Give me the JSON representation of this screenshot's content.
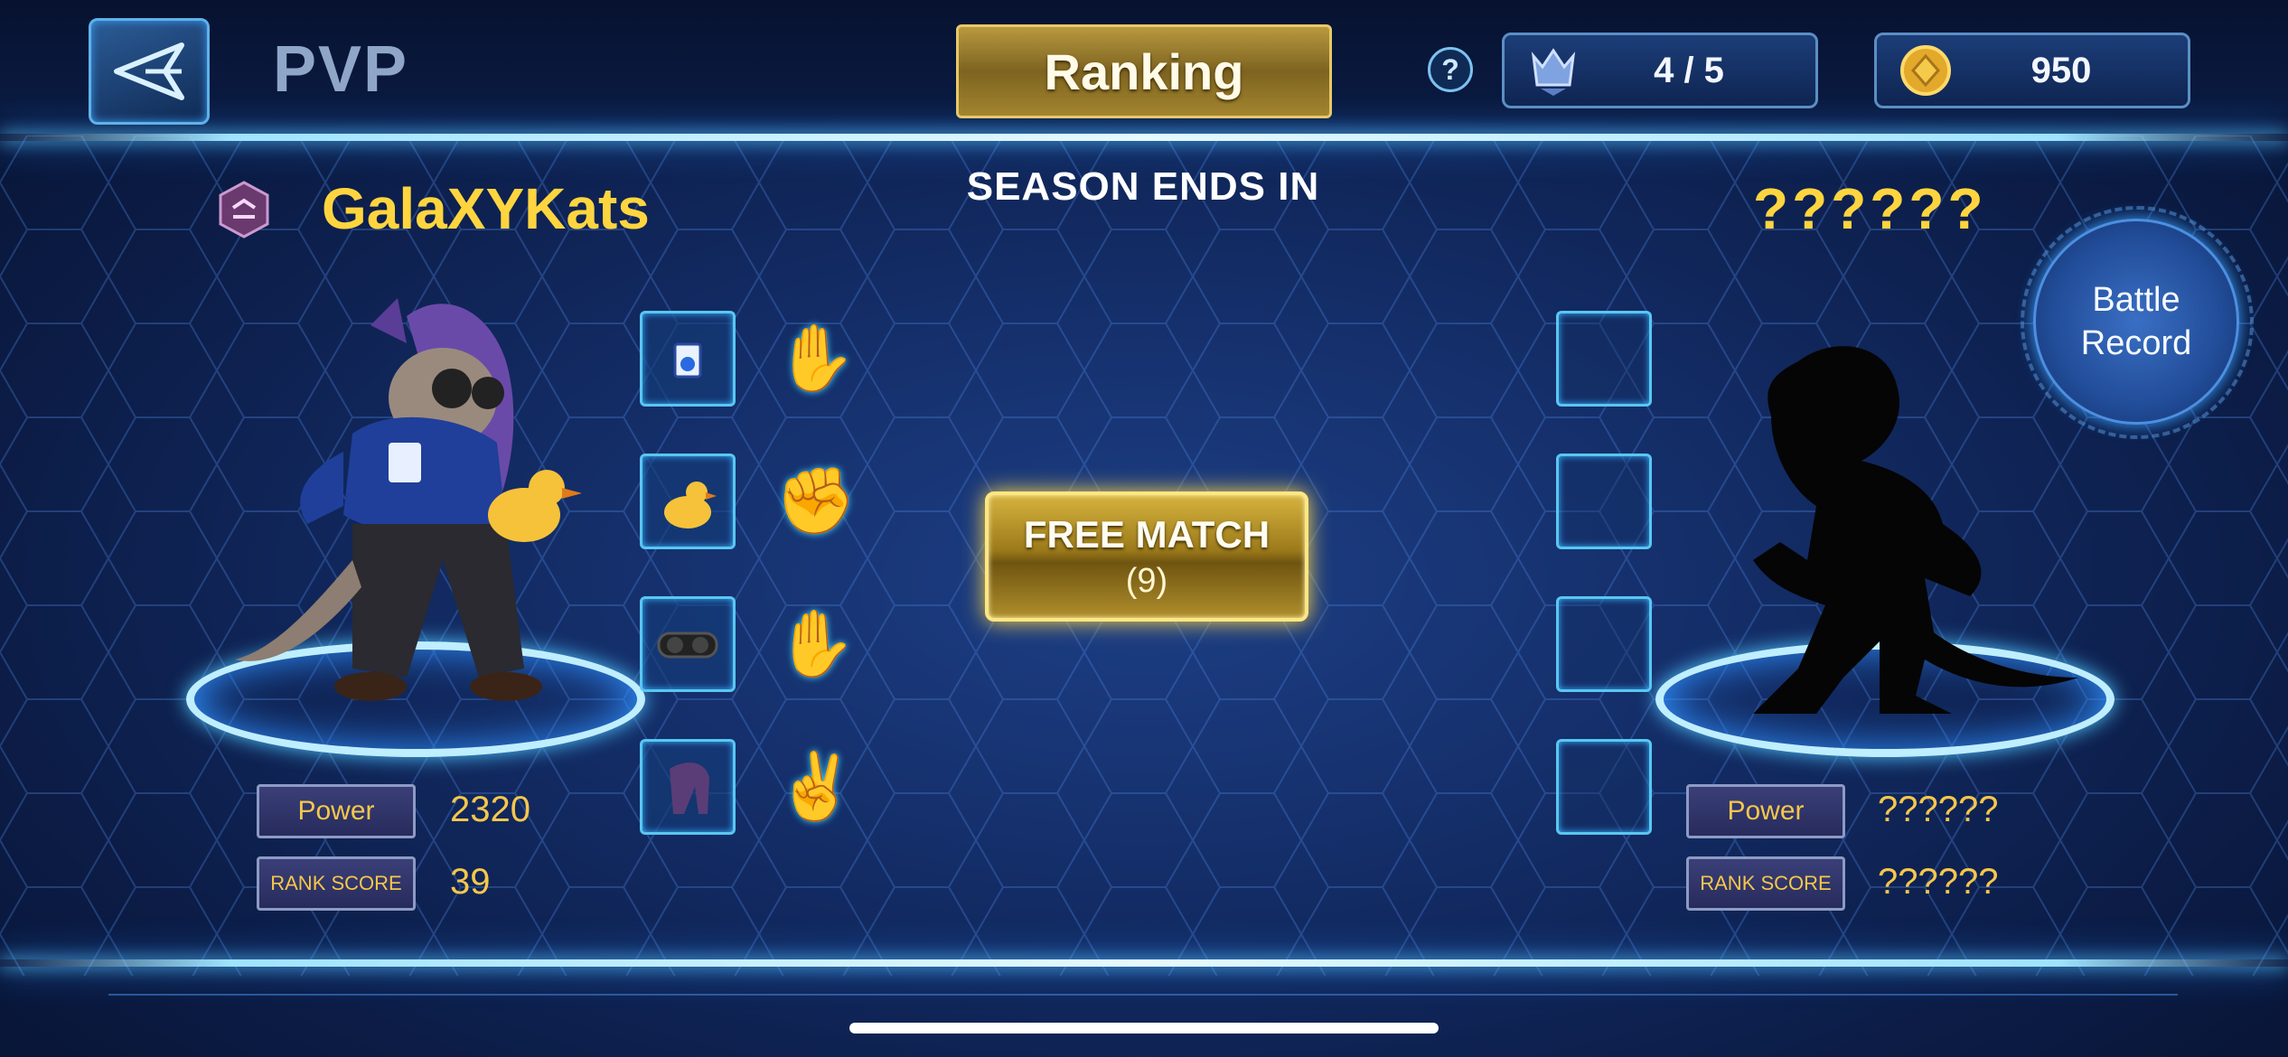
{
  "header": {
    "title": "PVP",
    "ranking_label": "Ranking",
    "help_label": "?",
    "tickets": "4 / 5",
    "coins": "950"
  },
  "season": {
    "label": "SEASON ENDS IN"
  },
  "player": {
    "name": "GalaXYKats",
    "power_label": "Power",
    "power_value": "2320",
    "rank_label": "RANK SCORE",
    "rank_value": "39",
    "moves": [
      "open-hand",
      "fist",
      "open-hand",
      "peace"
    ]
  },
  "opponent": {
    "name": "??????",
    "power_label": "Power",
    "power_value": "??????",
    "rank_label": "RANK SCORE",
    "rank_value": "??????"
  },
  "match": {
    "label": "FREE MATCH",
    "count": "(9)"
  },
  "battle_record": {
    "line1": "Battle",
    "line2": "Record"
  },
  "colors": {
    "gold": "#f6c74b",
    "name_yellow": "#ffd53f",
    "cyan_glow": "#8ff0ff",
    "panel_blue": "#142e69"
  }
}
